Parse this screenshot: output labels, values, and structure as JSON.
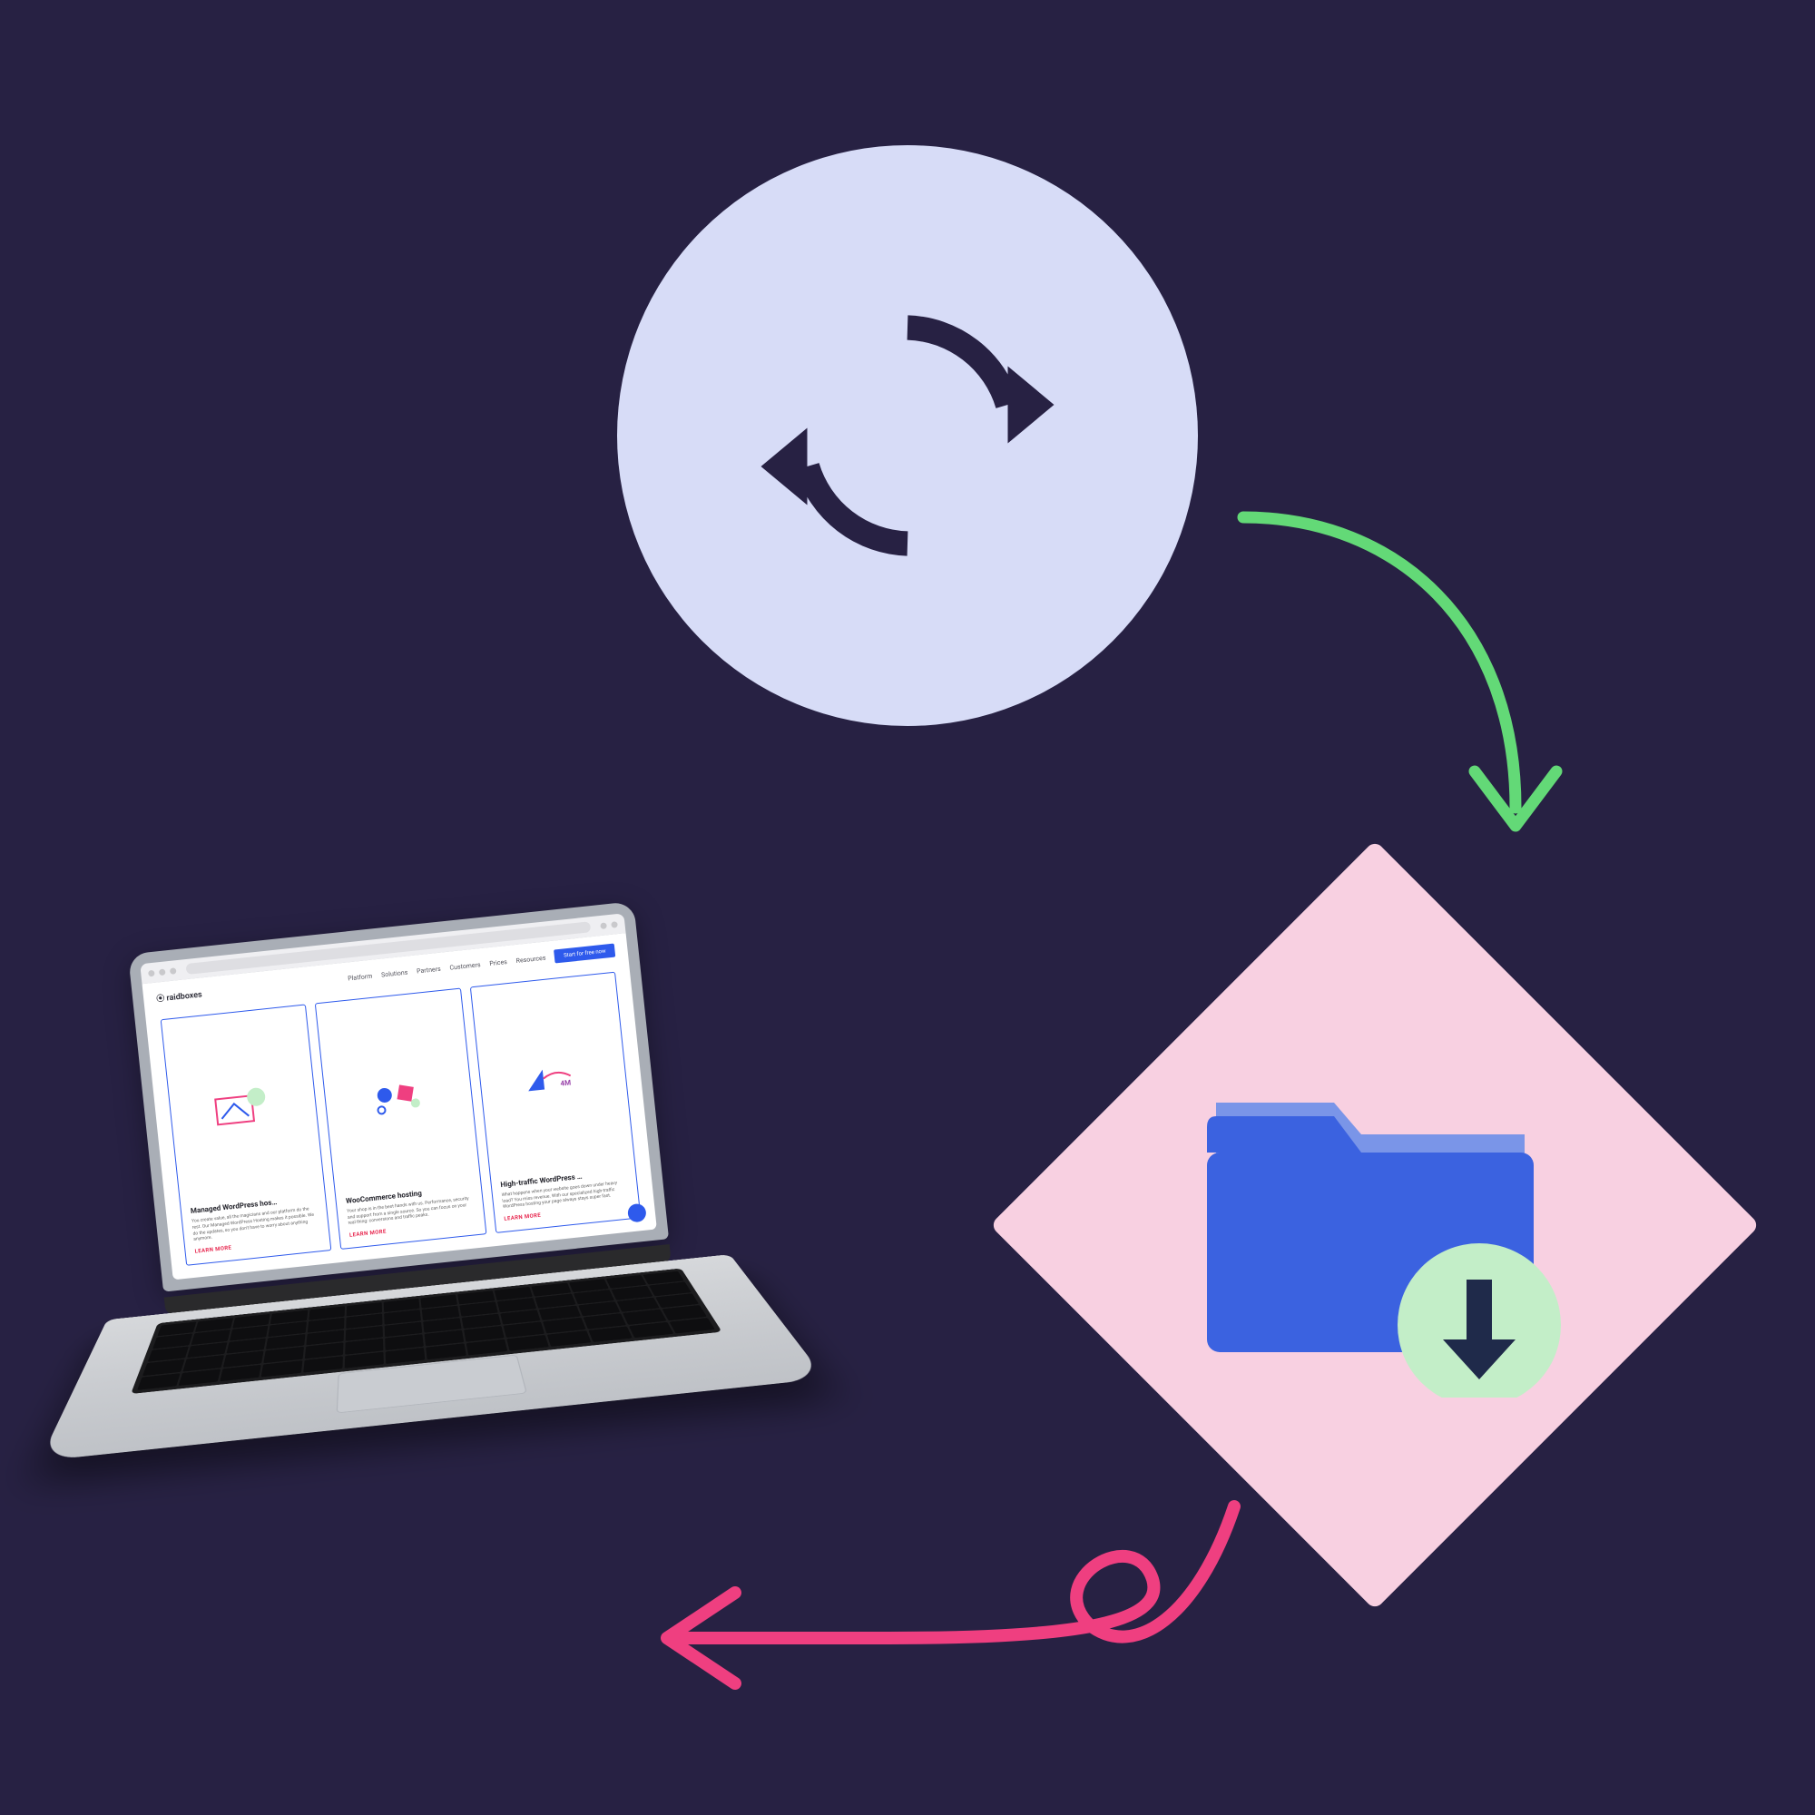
{
  "diagram": {
    "nodes": {
      "refresh": {
        "icon": "refresh-cycle-icon",
        "shape": "circle",
        "bg": "#d7dcf7",
        "fg": "#272143"
      },
      "folder_download": {
        "icon": "folder-download-icon",
        "shape": "diamond",
        "bg": "#f8d0e1",
        "folder": "#3b62e0",
        "badge": "#c3eec8",
        "arrow": "#1f2a4a"
      },
      "laptop": {
        "icon": "laptop-browser-icon"
      }
    },
    "arrows": [
      {
        "from": "refresh",
        "to": "folder_download",
        "color": "#63d977"
      },
      {
        "from": "folder_download",
        "to": "laptop",
        "color": "#ef3f80"
      }
    ]
  },
  "laptop_screen": {
    "logo": "⦿ raidboxes",
    "nav": [
      "Platform",
      "Solutions",
      "Partners",
      "Customers",
      "Prices",
      "Resources"
    ],
    "cta": "Start for free now",
    "cards": [
      {
        "title": "Managed WordPress hos…",
        "text": "You create value, all the magicians and our platform do the rest. Our Managed WordPress Hosting makes it possible. We do the updates, so you don't have to worry about anything anymore.",
        "link": "LEARN MORE"
      },
      {
        "title": "WooCommerce hosting",
        "text": "Your shop is in the best hands with us. Performance, security and support from a single source. So you can focus on your real thing: conversions and traffic peaks.",
        "link": "LEARN MORE"
      },
      {
        "title": "High-traffic WordPress …",
        "text": "What happens when your website goes down under heavy load? You miss revenue. With our specialized high-traffic WordPress hosting your page always stays super fast.",
        "link": "LEARN MORE"
      }
    ]
  },
  "colors": {
    "bg": "#272143",
    "lilac": "#d7dcf7",
    "pink_tile": "#f8d0e1",
    "green_arrow": "#63d977",
    "pink_arrow": "#ef3f80",
    "blue": "#2e5aec"
  }
}
